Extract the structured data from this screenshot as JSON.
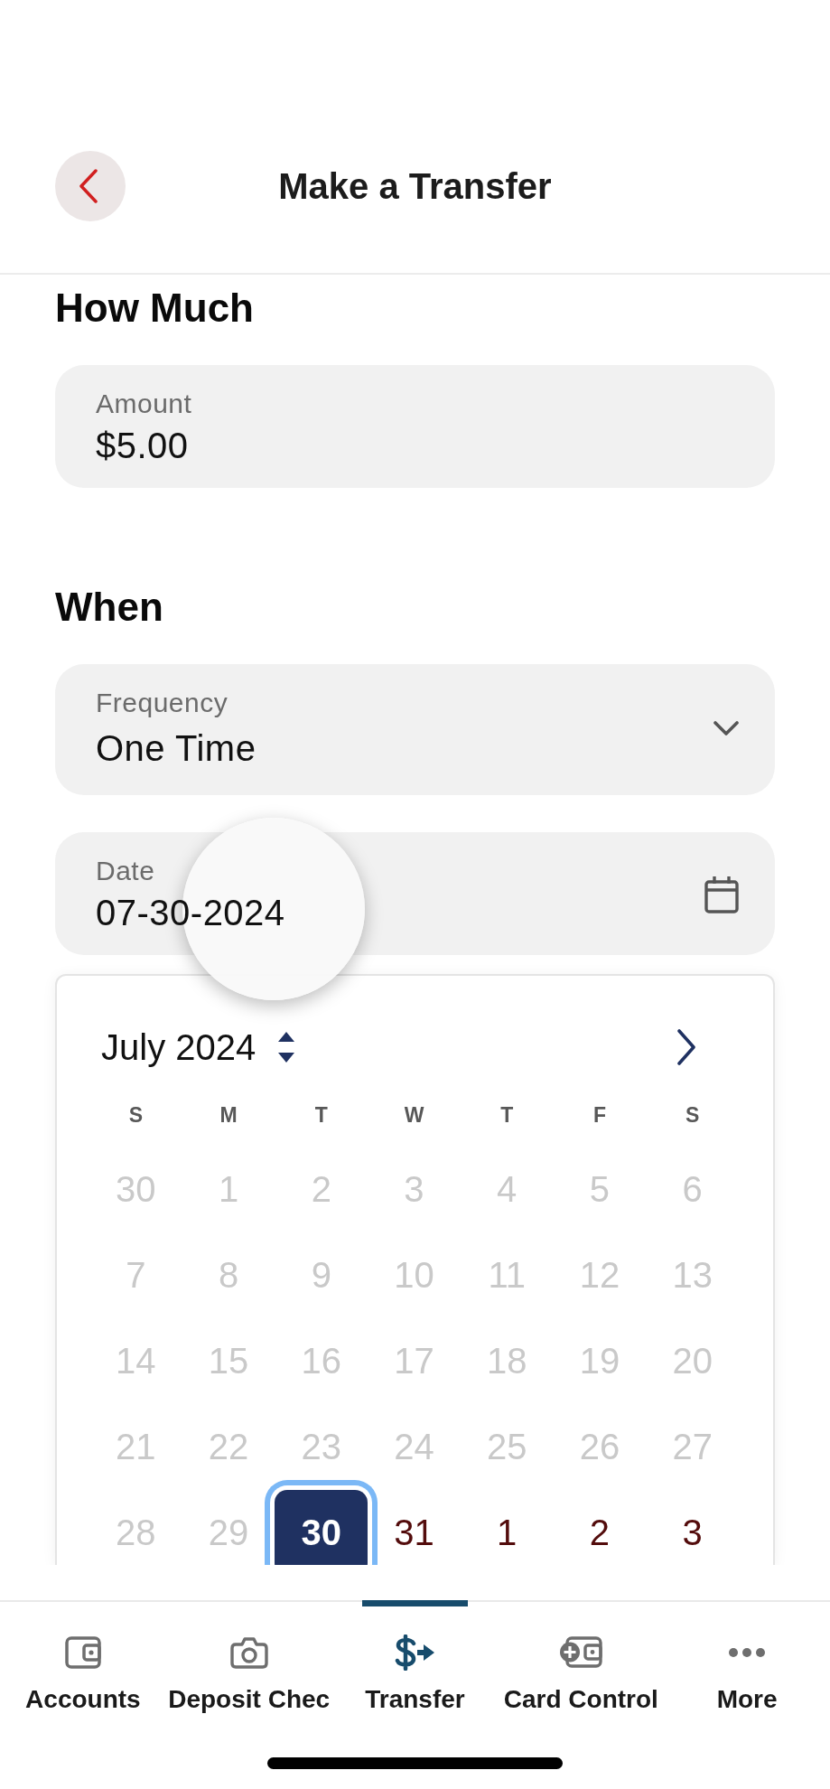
{
  "header": {
    "title": "Make a Transfer"
  },
  "sections": [
    {
      "heading": "How Much",
      "fields": [
        {
          "kind": "text",
          "label": "Amount",
          "value": "$5.00"
        }
      ]
    },
    {
      "heading": "When",
      "fields": [
        {
          "kind": "select",
          "label": "Frequency",
          "value": "One Time"
        },
        {
          "kind": "date",
          "label": "Date",
          "value": "07-30-2024",
          "magnifier_shown": true
        }
      ]
    }
  ],
  "date_picker": {
    "month": "July 2024",
    "weekdays": [
      "S",
      "M",
      "T",
      "W",
      "T",
      "F",
      "S"
    ],
    "weeks": [
      [
        {
          "label": "30",
          "disabled": true,
          "selected": false
        },
        {
          "label": "1",
          "disabled": true,
          "selected": false
        },
        {
          "label": "2",
          "disabled": true,
          "selected": false
        },
        {
          "label": "3",
          "disabled": true,
          "selected": false
        },
        {
          "label": "4",
          "disabled": true,
          "selected": false
        },
        {
          "label": "5",
          "disabled": true,
          "selected": false
        },
        {
          "label": "6",
          "disabled": true,
          "selected": false
        }
      ],
      [
        {
          "label": "7",
          "disabled": true,
          "selected": false
        },
        {
          "label": "8",
          "disabled": true,
          "selected": false
        },
        {
          "label": "9",
          "disabled": true,
          "selected": false
        },
        {
          "label": "10",
          "disabled": true,
          "selected": false
        },
        {
          "label": "11",
          "disabled": true,
          "selected": false
        },
        {
          "label": "12",
          "disabled": true,
          "selected": false
        },
        {
          "label": "13",
          "disabled": true,
          "selected": false
        }
      ],
      [
        {
          "label": "14",
          "disabled": true,
          "selected": false
        },
        {
          "label": "15",
          "disabled": true,
          "selected": false
        },
        {
          "label": "16",
          "disabled": true,
          "selected": false
        },
        {
          "label": "17",
          "disabled": true,
          "selected": false
        },
        {
          "label": "18",
          "disabled": true,
          "selected": false
        },
        {
          "label": "19",
          "disabled": true,
          "selected": false
        },
        {
          "label": "20",
          "disabled": true,
          "selected": false
        }
      ],
      [
        {
          "label": "21",
          "disabled": true,
          "selected": false
        },
        {
          "label": "22",
          "disabled": true,
          "selected": false
        },
        {
          "label": "23",
          "disabled": true,
          "selected": false
        },
        {
          "label": "24",
          "disabled": true,
          "selected": false
        },
        {
          "label": "25",
          "disabled": true,
          "selected": false
        },
        {
          "label": "26",
          "disabled": true,
          "selected": false
        },
        {
          "label": "27",
          "disabled": true,
          "selected": false
        }
      ],
      [
        {
          "label": "28",
          "disabled": true,
          "selected": false
        },
        {
          "label": "29",
          "disabled": true,
          "selected": false
        },
        {
          "label": "30",
          "disabled": false,
          "selected": true
        },
        {
          "label": "31",
          "disabled": false,
          "selected": false
        },
        {
          "label": "1",
          "disabled": false,
          "selected": false
        },
        {
          "label": "2",
          "disabled": false,
          "selected": false
        },
        {
          "label": "3",
          "disabled": false,
          "selected": false
        }
      ]
    ]
  },
  "tab_bar": [
    {
      "label": "Accounts",
      "selected": false
    },
    {
      "label": "Deposit Chec",
      "selected": false
    },
    {
      "label": "Transfer",
      "selected": true
    },
    {
      "label": "Card Control",
      "selected": false
    },
    {
      "label": "More",
      "selected": false
    }
  ]
}
